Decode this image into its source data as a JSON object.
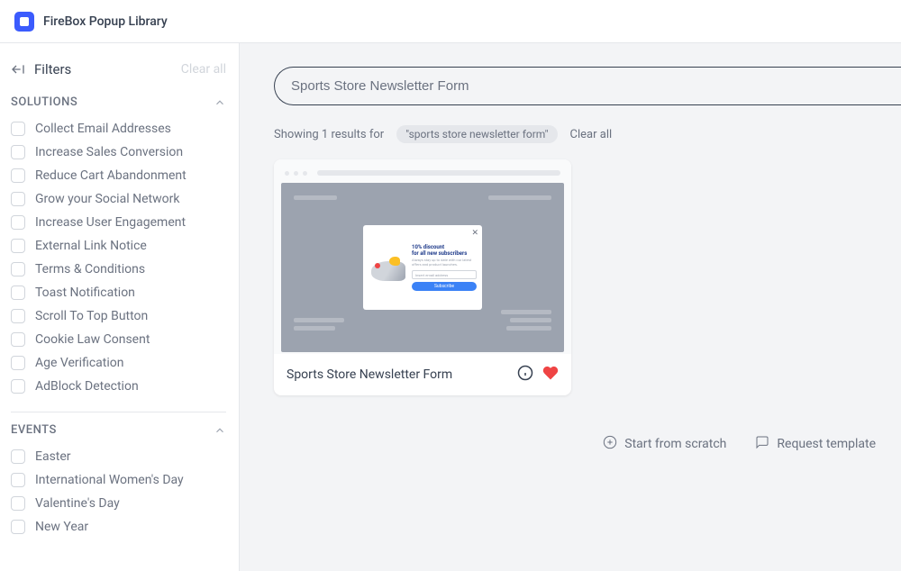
{
  "header": {
    "title": "FireBox Popup Library"
  },
  "sidebar": {
    "filters_label": "Filters",
    "clear_all": "Clear all",
    "sections": [
      {
        "title": "SOLUTIONS",
        "items": [
          "Collect Email Addresses",
          "Increase Sales Conversion",
          "Reduce Cart Abandonment",
          "Grow your Social Network",
          "Increase User Engagement",
          "External Link Notice",
          "Terms & Conditions",
          "Toast Notification",
          "Scroll To Top Button",
          "Cookie Law Consent",
          "Age Verification",
          "AdBlock Detection"
        ]
      },
      {
        "title": "EVENTS",
        "items": [
          "Easter",
          "International Women's Day",
          "Valentine's Day",
          "New Year"
        ]
      }
    ]
  },
  "main": {
    "search_value": "Sports Store Newsletter Form",
    "results_text": "Showing 1 results for",
    "search_term": "\"sports store newsletter form\"",
    "clear_all": "Clear all",
    "card": {
      "title": "Sports Store Newsletter Form",
      "preview": {
        "popup_title1": "10% discount",
        "popup_title2": "for all new subscribers",
        "popup_sub": "Always stay up to date with our latest offers and product launches.",
        "popup_input": "Insert email address",
        "popup_btn": "Subscribe"
      }
    },
    "actions": {
      "start_from_scratch": "Start from scratch",
      "request_template": "Request template"
    }
  }
}
